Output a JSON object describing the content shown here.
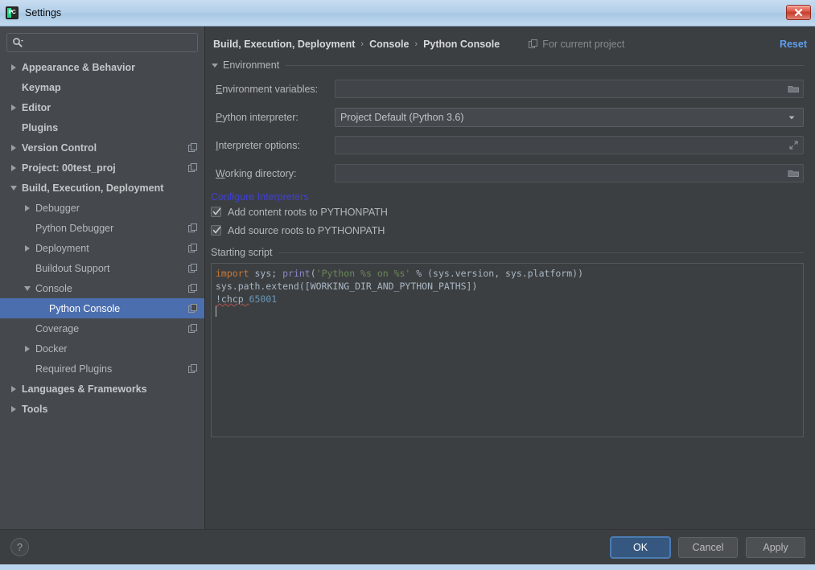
{
  "window": {
    "title": "Settings",
    "app_icon": "pycharm-icon",
    "close_label": "✕"
  },
  "sidebar": {
    "search": {
      "placeholder": "",
      "value": "",
      "icon": "search-icon"
    },
    "items": [
      {
        "label": "Appearance & Behavior",
        "level": 0,
        "arrow": "right",
        "bold": true,
        "module_icon": false,
        "selected": false
      },
      {
        "label": "Keymap",
        "level": 0,
        "arrow": "none",
        "bold": true,
        "module_icon": false,
        "selected": false
      },
      {
        "label": "Editor",
        "level": 0,
        "arrow": "right",
        "bold": true,
        "module_icon": false,
        "selected": false
      },
      {
        "label": "Plugins",
        "level": 0,
        "arrow": "none",
        "bold": true,
        "module_icon": false,
        "selected": false
      },
      {
        "label": "Version Control",
        "level": 0,
        "arrow": "right",
        "bold": true,
        "module_icon": true,
        "selected": false
      },
      {
        "label": "Project: 00test_proj",
        "level": 0,
        "arrow": "right",
        "bold": true,
        "module_icon": true,
        "selected": false
      },
      {
        "label": "Build, Execution, Deployment",
        "level": 0,
        "arrow": "down",
        "bold": true,
        "module_icon": false,
        "selected": false
      },
      {
        "label": "Debugger",
        "level": 1,
        "arrow": "right",
        "bold": false,
        "module_icon": false,
        "selected": false
      },
      {
        "label": "Python Debugger",
        "level": 1,
        "arrow": "none",
        "bold": false,
        "module_icon": true,
        "selected": false
      },
      {
        "label": "Deployment",
        "level": 1,
        "arrow": "right",
        "bold": false,
        "module_icon": true,
        "selected": false
      },
      {
        "label": "Buildout Support",
        "level": 1,
        "arrow": "none",
        "bold": false,
        "module_icon": true,
        "selected": false
      },
      {
        "label": "Console",
        "level": 1,
        "arrow": "down",
        "bold": false,
        "module_icon": true,
        "selected": false
      },
      {
        "label": "Python Console",
        "level": 2,
        "arrow": "none",
        "bold": false,
        "module_icon": true,
        "selected": true
      },
      {
        "label": "Coverage",
        "level": 1,
        "arrow": "none",
        "bold": false,
        "module_icon": true,
        "selected": false
      },
      {
        "label": "Docker",
        "level": 1,
        "arrow": "right",
        "bold": false,
        "module_icon": false,
        "selected": false
      },
      {
        "label": "Required Plugins",
        "level": 1,
        "arrow": "none",
        "bold": false,
        "module_icon": true,
        "selected": false
      },
      {
        "label": "Languages & Frameworks",
        "level": 0,
        "arrow": "right",
        "bold": true,
        "module_icon": false,
        "selected": false
      },
      {
        "label": "Tools",
        "level": 0,
        "arrow": "right",
        "bold": true,
        "module_icon": false,
        "selected": false
      }
    ]
  },
  "header": {
    "breadcrumbs": [
      "Build, Execution, Deployment",
      "Console",
      "Python Console"
    ],
    "separator": "›",
    "scope_label": "For current project",
    "scope_icon": "module-icon",
    "reset_label": "Reset",
    "reset_color": "#5d9ff0"
  },
  "environment": {
    "section_title": "Environment",
    "fields": [
      {
        "label": "Environment variables:",
        "mnemonic": "E",
        "rest": "nvironment variables:",
        "value": "",
        "kind": "text",
        "button_icon": "folder-icon"
      },
      {
        "label": "Python interpreter:",
        "mnemonic": "P",
        "rest": "ython interpreter:",
        "value": "Project Default (Python 3.6)",
        "kind": "combo",
        "button_icon": "chevron-down-icon"
      },
      {
        "label": "Interpreter options:",
        "mnemonic": "I",
        "rest": "nterpreter options:",
        "value": "",
        "kind": "text",
        "button_icon": "expand-icon"
      },
      {
        "label": "Working directory:",
        "mnemonic": "W",
        "rest": "orking directory:",
        "value": "",
        "kind": "text",
        "button_icon": "folder-icon"
      }
    ],
    "configure_link": "Configure Interpreters",
    "configure_link_color": "#4040d0",
    "checkboxes": [
      {
        "label": "Add content roots to PYTHONPATH",
        "checked": true
      },
      {
        "label": "Add source roots to PYTHONPATH",
        "checked": true
      }
    ]
  },
  "starting_script": {
    "title": "Starting script",
    "lines": [
      [
        {
          "t": "import",
          "c": "kw"
        },
        {
          "t": " sys; ",
          "c": "plain"
        },
        {
          "t": "print",
          "c": "fn"
        },
        {
          "t": "(",
          "c": "plain"
        },
        {
          "t": "'Python %s on %s'",
          "c": "str"
        },
        {
          "t": " % (sys.version, sys.platform))",
          "c": "plain"
        }
      ],
      [
        {
          "t": "sys.path.extend([WORKING_DIR_AND_PYTHON_PATHS])",
          "c": "plain"
        }
      ],
      [
        {
          "t": "!chcp ",
          "c": "sql"
        },
        {
          "t": "65001",
          "c": "num"
        }
      ],
      []
    ],
    "colors": {
      "keyword": "#cc7832",
      "function": "#8888c6",
      "string": "#6a8759",
      "number": "#6897bb",
      "plain": "#a9b7c6"
    }
  },
  "footer": {
    "help_label": "?",
    "ok_label": "OK",
    "cancel_label": "Cancel",
    "apply_label": "Apply"
  }
}
